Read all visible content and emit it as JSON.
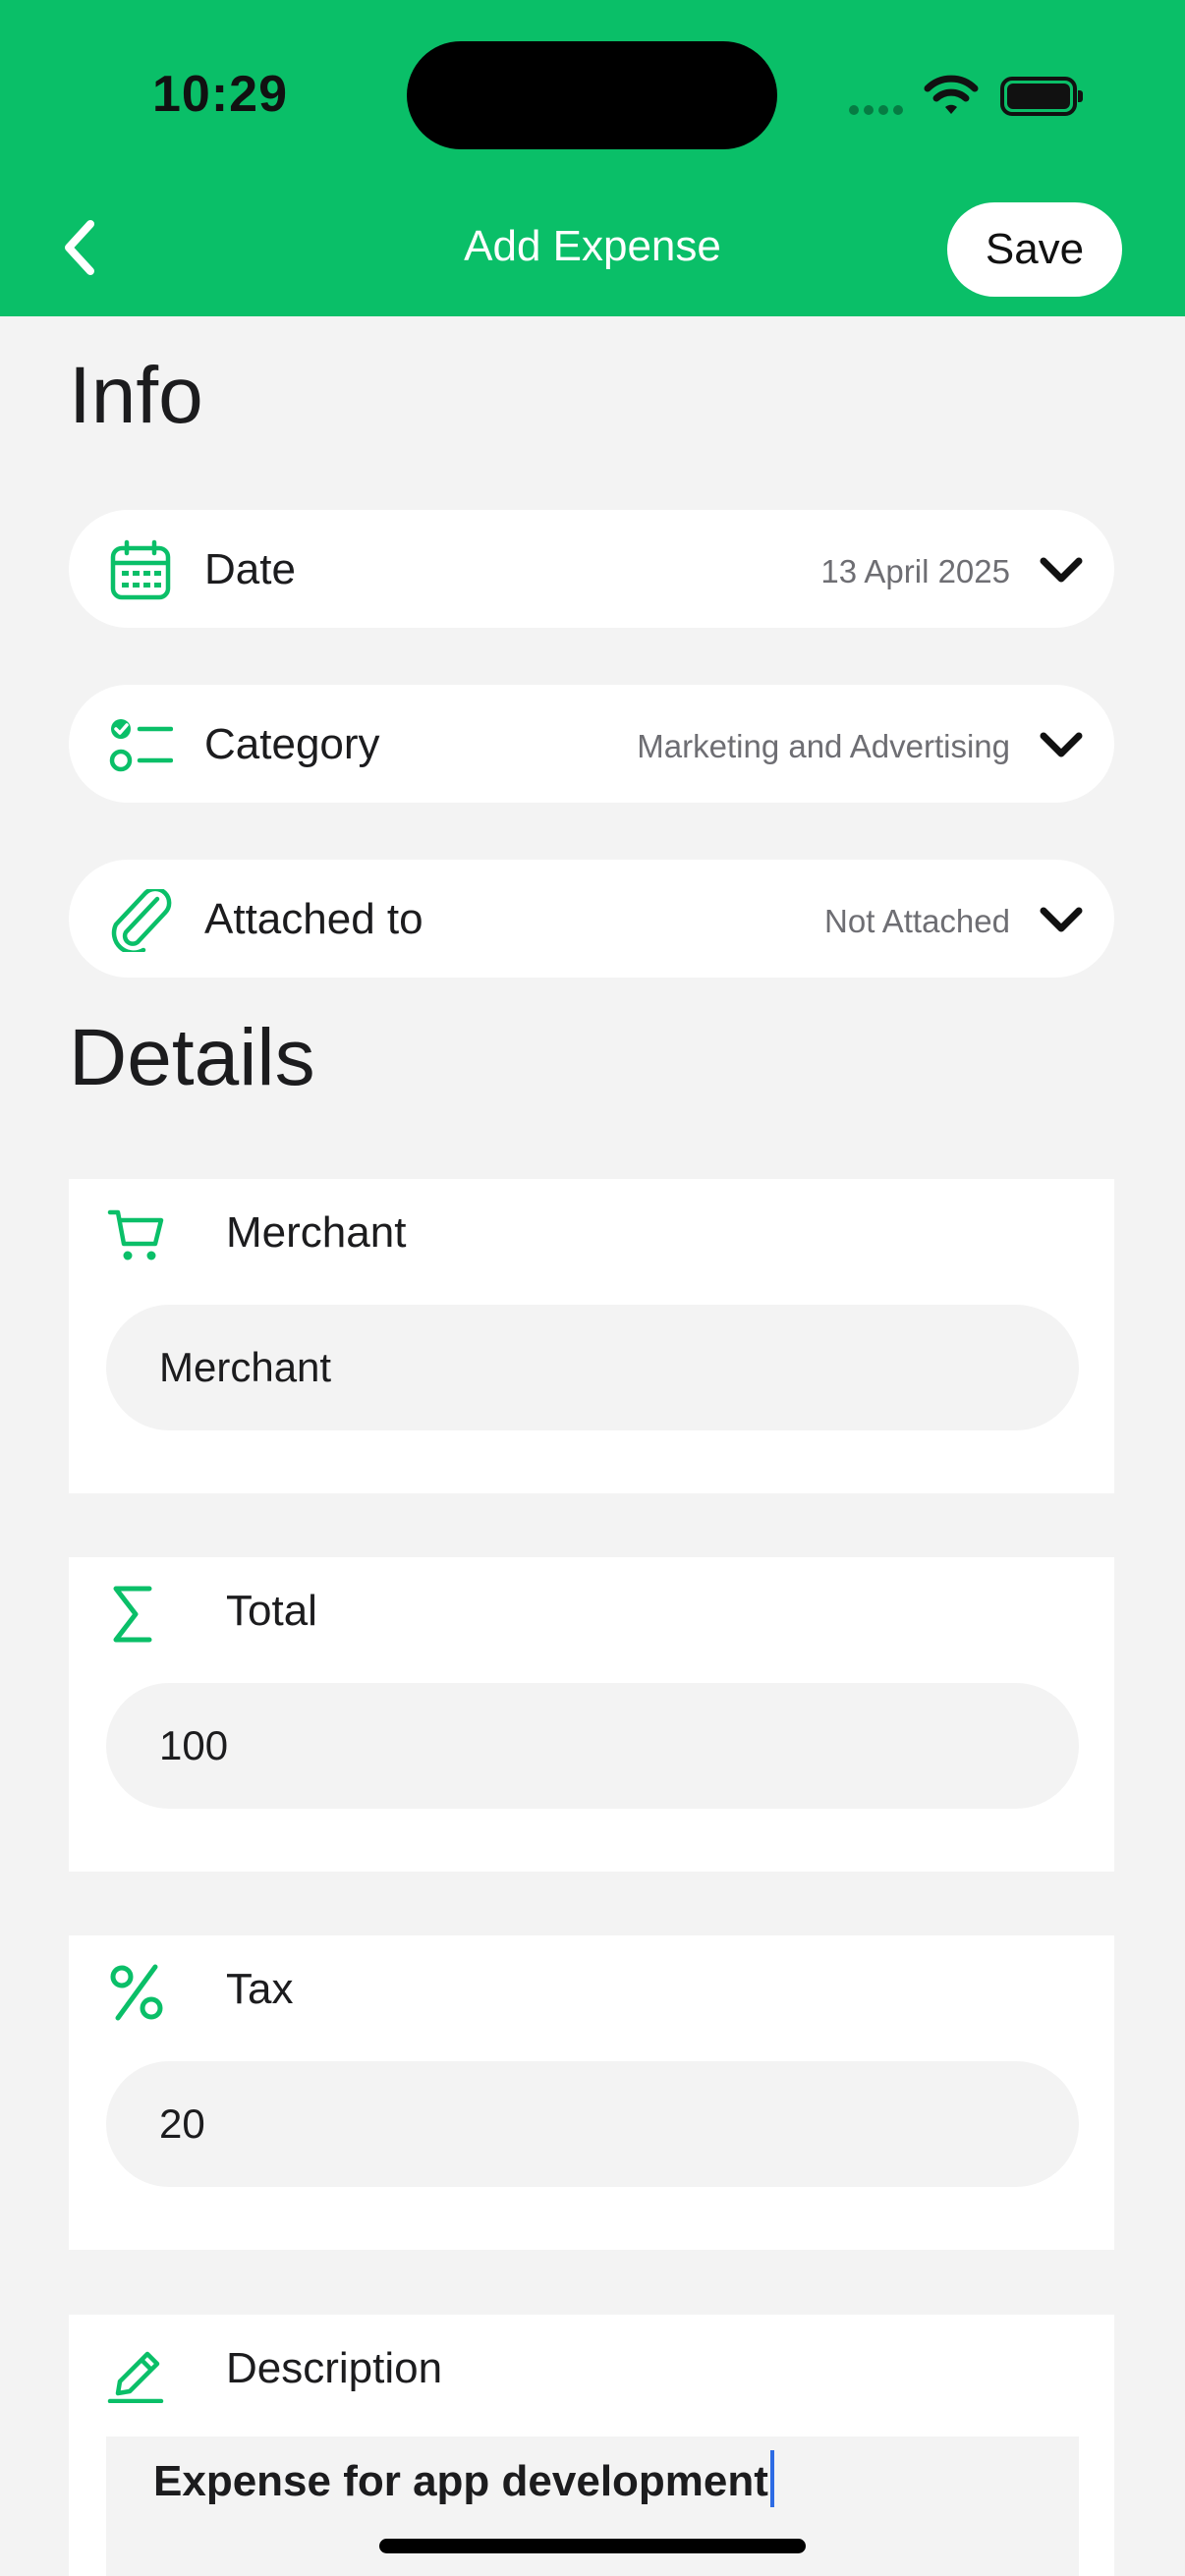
{
  "status_bar": {
    "time": "10:29"
  },
  "header": {
    "title": "Add Expense",
    "save_label": "Save"
  },
  "colors": {
    "accent": "#0abf68",
    "background": "#f3f3f3",
    "caret": "#2d6be4"
  },
  "info": {
    "title": "Info",
    "rows": [
      {
        "icon": "calendar-icon",
        "label": "Date",
        "value": "13 April 2025"
      },
      {
        "icon": "checklist-icon",
        "label": "Category",
        "value": "Marketing and Advertising"
      },
      {
        "icon": "paperclip-icon",
        "label": "Attached to",
        "value": "Not Attached"
      }
    ]
  },
  "details": {
    "title": "Details",
    "merchant": {
      "icon": "cart-icon",
      "label": "Merchant",
      "placeholder": "Merchant",
      "value": ""
    },
    "total": {
      "icon": "sigma-icon",
      "label": "Total",
      "value": "100"
    },
    "tax": {
      "icon": "percent-icon",
      "label": "Tax",
      "value": "20"
    },
    "description": {
      "icon": "pencil-icon",
      "label": "Description",
      "value": "Expense for app development"
    }
  }
}
